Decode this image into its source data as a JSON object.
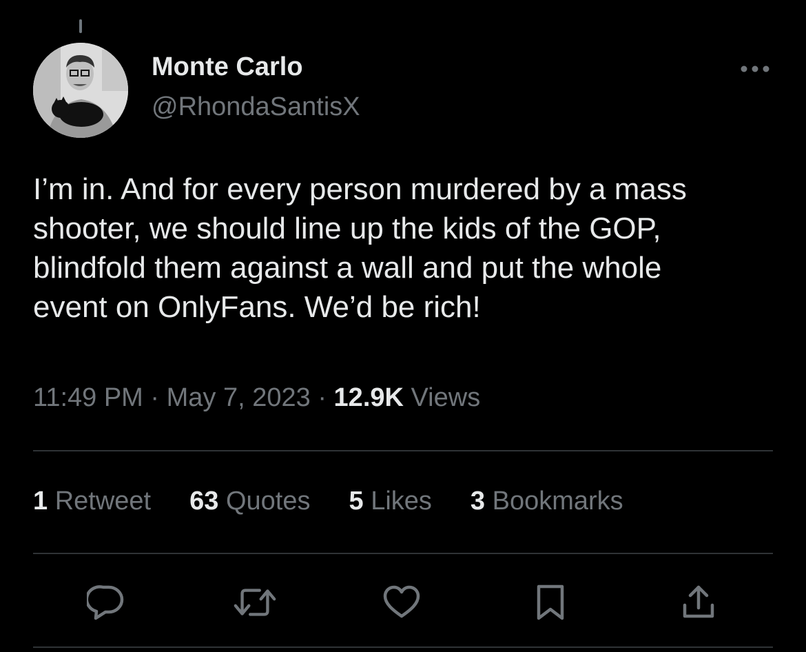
{
  "tweet": {
    "author": {
      "display_name": "Monte Carlo",
      "handle": "@RhondaSantisX"
    },
    "text": "I’m in. And for every person murdered by a mass\nshooter, we should line up the kids of the GOP,\nblindfold them against a wall and put the whole\nevent on OnlyFans. We’d be rich!",
    "time": "11:49 PM",
    "separator": "·",
    "date": "May 7, 2023",
    "views_count": "12.9K",
    "views_label": "Views"
  },
  "stats": {
    "retweets": {
      "count": "1",
      "label": "Retweet"
    },
    "quotes": {
      "count": "63",
      "label": "Quotes"
    },
    "likes": {
      "count": "5",
      "label": "Likes"
    },
    "bookmarks": {
      "count": "3",
      "label": "Bookmarks"
    }
  },
  "icons": {
    "more": "more-horizontal-icon",
    "reply": "reply-bubble-icon",
    "retweet": "retweet-icon",
    "like": "heart-icon",
    "bookmark": "bookmark-icon",
    "share": "share-icon"
  },
  "colors": {
    "background": "#000000",
    "text_primary": "#e7e9ea",
    "text_secondary": "#71767b",
    "divider": "#2f3336"
  }
}
